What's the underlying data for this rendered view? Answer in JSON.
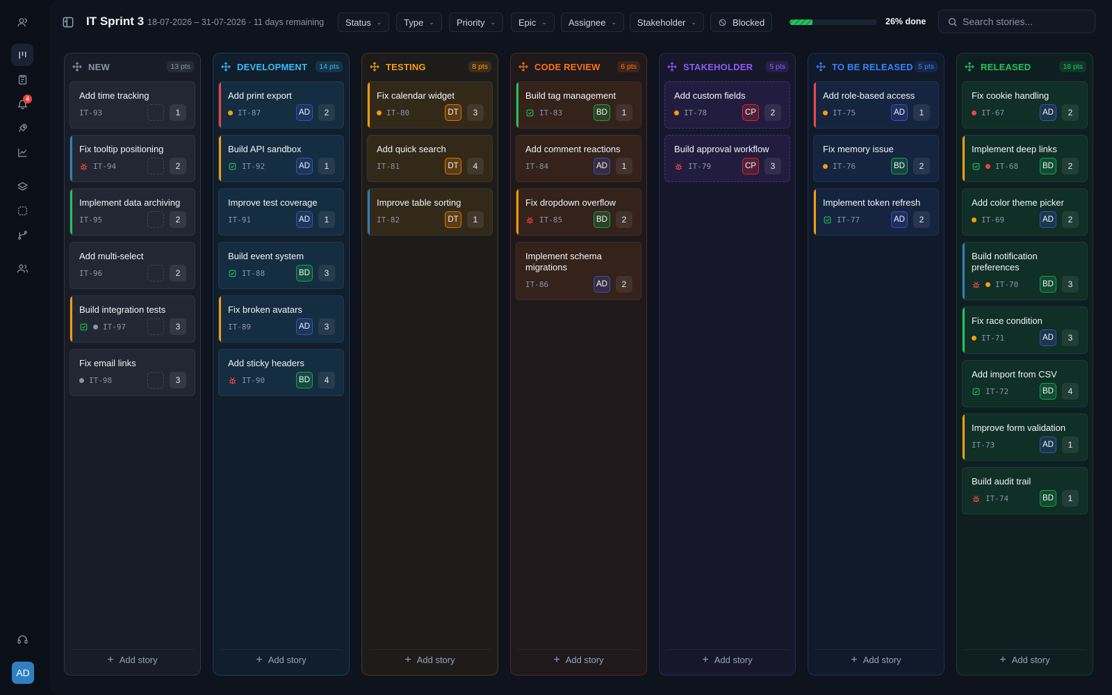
{
  "app": {
    "notifications_count": "4",
    "user_initials": "AD"
  },
  "header": {
    "title": "IT Sprint 3",
    "dates": "18-07-2026 – 31-07-2026 · 11 days remaining",
    "filters": [
      "Status",
      "Type",
      "Priority",
      "Epic",
      "Assignee",
      "Stakeholder",
      "Blocked"
    ],
    "progress_fraction": 0.26,
    "progress_label": "26% done",
    "search_placeholder": "Search stories..."
  },
  "board": {
    "add_story_label": "Add story",
    "columns": [
      {
        "name": "NEW",
        "points": "13 pts",
        "color": "#8b95a7",
        "cards": [
          {
            "title": "Add time tracking",
            "key": "IT-93",
            "type": "",
            "priority": "",
            "assignee": "",
            "points": "1"
          },
          {
            "title": "Fix tooltip positioning",
            "key": "IT-94",
            "type": "bug",
            "priority": "",
            "assignee": "",
            "points": "2",
            "border": "#2f7fc1"
          },
          {
            "title": "Implement data archiving",
            "key": "IT-95",
            "type": "",
            "priority": "",
            "assignee": "",
            "points": "2",
            "border": "#22c55e"
          },
          {
            "title": "Add multi-select",
            "key": "IT-96",
            "type": "",
            "priority": "",
            "assignee": "",
            "points": "2"
          },
          {
            "title": "Build integration tests",
            "key": "IT-97",
            "type": "task",
            "priority": "low",
            "assignee": "",
            "points": "3",
            "border": "#f59e0b"
          },
          {
            "title": "Fix email links",
            "key": "IT-98",
            "type": "",
            "priority": "low",
            "assignee": "",
            "points": "3"
          }
        ]
      },
      {
        "name": "DEVELOPMENT",
        "points": "14 pts",
        "color": "#38bdf8",
        "cards": [
          {
            "title": "Add print export",
            "key": "IT-87",
            "type": "",
            "priority": "medium",
            "assignee": "AD",
            "points": "2",
            "border": "#ef4444"
          },
          {
            "title": "Build API sandbox",
            "key": "IT-92",
            "type": "task",
            "priority": "",
            "assignee": "AD",
            "points": "1",
            "border": "#f59e0b"
          },
          {
            "title": "Improve test coverage",
            "key": "IT-91",
            "type": "",
            "priority": "",
            "assignee": "AD",
            "points": "1"
          },
          {
            "title": "Build event system",
            "key": "IT-88",
            "type": "task",
            "priority": "",
            "assignee": "BD",
            "points": "3"
          },
          {
            "title": "Fix broken avatars",
            "key": "IT-89",
            "type": "",
            "priority": "",
            "assignee": "AD",
            "points": "3",
            "border": "#f59e0b"
          },
          {
            "title": "Add sticky headers",
            "key": "IT-90",
            "type": "bug",
            "priority": "",
            "assignee": "BD",
            "points": "4"
          }
        ]
      },
      {
        "name": "TESTING",
        "points": "8 pts",
        "color": "#f59e0b",
        "cards": [
          {
            "title": "Fix calendar widget",
            "key": "IT-80",
            "type": "",
            "priority": "medium",
            "assignee": "DT",
            "points": "3",
            "border": "#f59e0b"
          },
          {
            "title": "Add quick search",
            "key": "IT-81",
            "type": "",
            "priority": "",
            "assignee": "DT",
            "points": "4"
          },
          {
            "title": "Improve table sorting",
            "key": "IT-82",
            "type": "",
            "priority": "",
            "assignee": "DT",
            "points": "1",
            "border": "#2f7fc1"
          }
        ]
      },
      {
        "name": "CODE REVIEW",
        "points": "6 pts",
        "color": "#f97316",
        "cards": [
          {
            "title": "Build tag management",
            "key": "IT-83",
            "type": "task",
            "priority": "",
            "assignee": "BD",
            "points": "1",
            "border": "#22c55e"
          },
          {
            "title": "Add comment reactions",
            "key": "IT-84",
            "type": "",
            "priority": "",
            "assignee": "AD",
            "points": "1"
          },
          {
            "title": "Fix dropdown overflow",
            "key": "IT-85",
            "type": "bug",
            "priority": "",
            "assignee": "BD",
            "points": "2",
            "border": "#f59e0b"
          },
          {
            "title": "Implement schema migrations",
            "key": "IT-86",
            "type": "",
            "priority": "",
            "assignee": "AD",
            "points": "2"
          }
        ]
      },
      {
        "name": "STAKEHOLDER",
        "points": "5 pts",
        "color": "#8b5cf6",
        "cards": [
          {
            "title": "Add custom fields",
            "key": "IT-78",
            "type": "",
            "priority": "medium",
            "assignee": "CP",
            "points": "2",
            "dashed": true
          },
          {
            "title": "Build approval workflow",
            "key": "IT-79",
            "type": "bug",
            "priority": "",
            "assignee": "CP",
            "points": "3",
            "dashed": true
          }
        ]
      },
      {
        "name": "TO BE RELEASED",
        "points": "5 pts",
        "color": "#3b82f6",
        "cards": [
          {
            "title": "Add role-based access",
            "key": "IT-75",
            "type": "",
            "priority": "medium",
            "assignee": "AD",
            "points": "1",
            "border": "#ef4444"
          },
          {
            "title": "Fix memory issue",
            "key": "IT-76",
            "type": "",
            "priority": "medium",
            "assignee": "BD",
            "points": "2"
          },
          {
            "title": "Implement token refresh",
            "key": "IT-77",
            "type": "task",
            "priority": "",
            "assignee": "AD",
            "points": "2",
            "border": "#f59e0b"
          }
        ]
      },
      {
        "name": "RELEASED",
        "points": "18 pts",
        "color": "#22c55e",
        "cards": [
          {
            "title": "Fix cookie handling",
            "key": "IT-67",
            "type": "",
            "priority": "high",
            "assignee": "AD",
            "points": "2"
          },
          {
            "title": "Implement deep links",
            "key": "IT-68",
            "type": "task",
            "priority": "high",
            "assignee": "BD",
            "points": "2",
            "border": "#f59e0b"
          },
          {
            "title": "Add color theme picker",
            "key": "IT-69",
            "type": "",
            "priority": "medium",
            "assignee": "AD",
            "points": "2"
          },
          {
            "title": "Build notification preferences",
            "key": "IT-70",
            "type": "bug",
            "priority": "medium",
            "assignee": "BD",
            "points": "3",
            "border": "#2f7fc1"
          },
          {
            "title": "Fix race condition",
            "key": "IT-71",
            "type": "",
            "priority": "medium",
            "assignee": "AD",
            "points": "3",
            "border": "#22c55e"
          },
          {
            "title": "Add import from CSV",
            "key": "IT-72",
            "type": "task",
            "priority": "",
            "assignee": "BD",
            "points": "4"
          },
          {
            "title": "Improve form validation",
            "key": "IT-73",
            "type": "",
            "priority": "",
            "assignee": "AD",
            "points": "1",
            "border": "#f59e0b"
          },
          {
            "title": "Build audit trail",
            "key": "IT-74",
            "type": "bug",
            "priority": "",
            "assignee": "BD",
            "points": "1"
          }
        ]
      }
    ]
  },
  "colors": {
    "priority_high": "#ef4444",
    "priority_medium": "#f59e0b",
    "priority_low": "#8b95a7",
    "assignee_AD": "#3b4fb8",
    "assignee_BD": "#16a34a",
    "assignee_DT": "#d97706",
    "assignee_CP": "#dc2626"
  },
  "icons": {
    "rail": [
      "user-group-icon",
      "board-icon",
      "clipboard-icon",
      "bell-icon",
      "rocket-icon",
      "chart-icon",
      "layers-icon",
      "selection-icon",
      "branch-icon",
      "team-icon",
      "headset-icon"
    ],
    "bug": "bug-icon",
    "task": "task-check-icon",
    "drag": "drag-handle-icon"
  }
}
